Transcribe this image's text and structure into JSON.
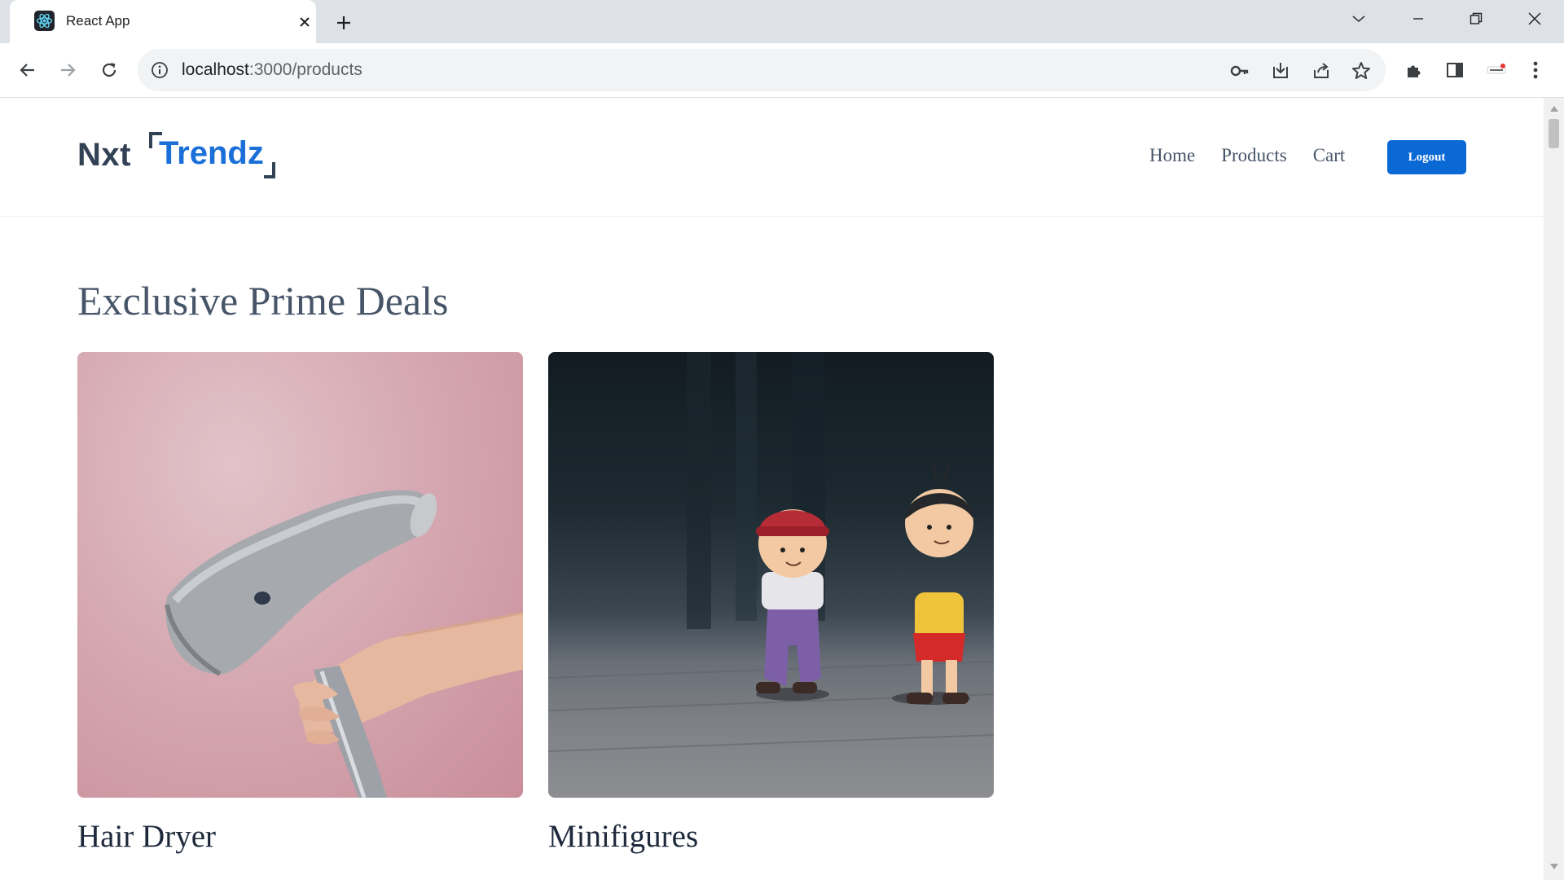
{
  "browser": {
    "tab_title": "React App",
    "url_host": "localhost",
    "url_path": ":3000/products"
  },
  "navbar": {
    "logo_part1": "Nxt",
    "logo_part2": "Trendz",
    "links": [
      "Home",
      "Products",
      "Cart"
    ],
    "logout_label": "Logout"
  },
  "prime_deals": {
    "title": "Exclusive Prime Deals",
    "products": [
      {
        "name": "Hair Dryer"
      },
      {
        "name": "Minifigures"
      }
    ]
  },
  "colors": {
    "brand_blue": "#0b69d5",
    "logo_dark": "#334155",
    "nav_text": "#475569"
  }
}
